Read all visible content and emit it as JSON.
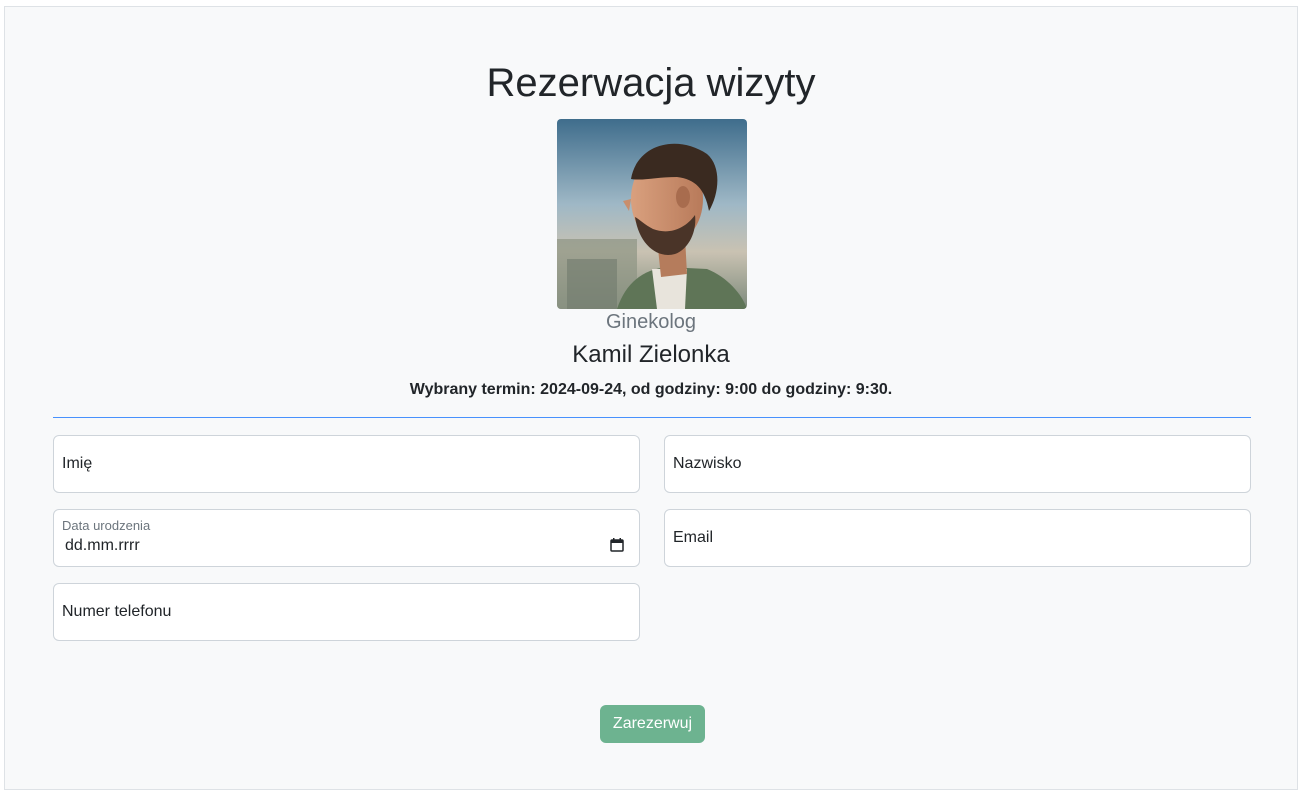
{
  "page": {
    "title": "Rezerwacja wizyty"
  },
  "doctor": {
    "photo_alt": "doctor-photo",
    "specialty": "Ginekolog",
    "name": "Kamil Zielonka"
  },
  "appointment": {
    "summary": "Wybrany termin: 2024-09-24, od godziny: 9:00 do godziny: 9:30."
  },
  "form": {
    "first_name_label": "Imię",
    "last_name_label": "Nazwisko",
    "birth_date_label": "Data urodzenia",
    "birth_date_value": "dd.mm.rrrr",
    "email_label": "Email",
    "phone_label": "Numer telefonu",
    "submit_label": "Zarezerwuj"
  },
  "colors": {
    "accent": "#0d6efd",
    "button": "#6db390",
    "background": "#f8f9fa",
    "muted_text": "#6c757d"
  }
}
